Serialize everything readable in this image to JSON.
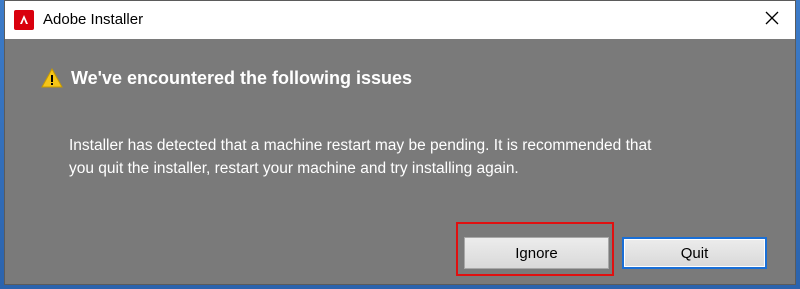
{
  "window": {
    "title": "Adobe Installer",
    "close_symbol": "✕"
  },
  "dialog": {
    "heading": "We've encountered the following issues",
    "message_line1": "Installer has detected that a machine restart may be pending. It is recommended that",
    "message_line2": "you quit the installer, restart your machine and try installing again."
  },
  "buttons": {
    "ignore_label": "Ignore",
    "quit_label": "Quit"
  },
  "colors": {
    "dialog_bg": "#7a7a7a",
    "highlight": "#e01010",
    "default_button_border": "#1a6fd6",
    "adobe_red": "#d9000d",
    "warning_yellow": "#f5c518"
  },
  "icons": {
    "app": "adobe-icon",
    "warning": "warning-icon",
    "close": "close-icon"
  }
}
